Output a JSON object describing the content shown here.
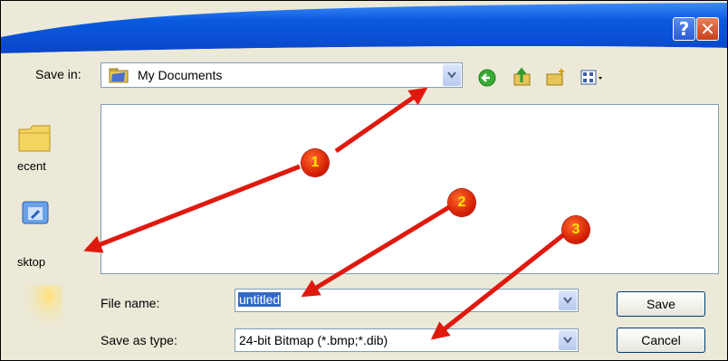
{
  "dialog": {
    "help_button": "?",
    "close_button": "✕"
  },
  "toolbar": {
    "save_in_label": "Save in:",
    "save_in_value": "My Documents",
    "icons": [
      "folder-documents-icon",
      "back-icon",
      "up-folder-icon",
      "new-folder-icon",
      "views-menu-icon"
    ]
  },
  "places": [
    {
      "label": "ecent",
      "icon": "recent-folder-icon"
    },
    {
      "label": "sktop",
      "icon": "desktop-icon"
    }
  ],
  "form": {
    "file_name_label": "File name:",
    "file_name_value": "untitled",
    "save_as_type_label": "Save as type:",
    "save_as_type_value": "24-bit Bitmap (*.bmp;*.dib)"
  },
  "buttons": {
    "save": "Save",
    "cancel": "Cancel"
  },
  "callouts": [
    "1",
    "2",
    "3"
  ],
  "colors": {
    "titlebar": "#0a5ae0",
    "callout": "#d01800",
    "arrow": "#e0190f",
    "selection": "#316ac5"
  }
}
